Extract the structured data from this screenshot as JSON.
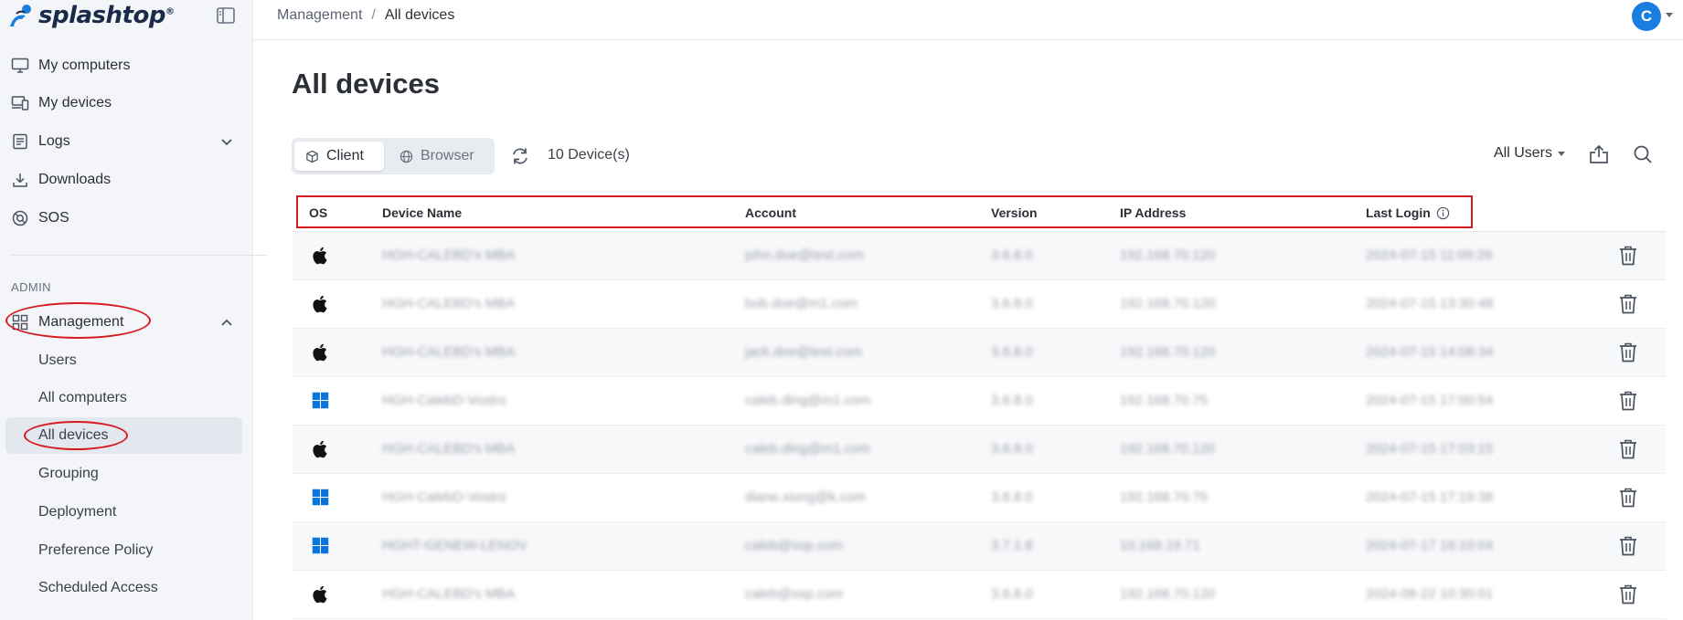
{
  "brand": {
    "name": "splashtop",
    "reg": "®"
  },
  "breadcrumb": {
    "parent": "Management",
    "separator": "/",
    "current": "All devices"
  },
  "user": {
    "initial": "C"
  },
  "sidebar": {
    "items": [
      {
        "label": "My computers",
        "icon": "monitor-icon"
      },
      {
        "label": "My devices",
        "icon": "devices-icon"
      },
      {
        "label": "Logs",
        "icon": "logs-icon"
      },
      {
        "label": "Downloads",
        "icon": "download-icon"
      },
      {
        "label": "SOS",
        "icon": "sos-icon"
      }
    ],
    "admin_label": "ADMIN",
    "management_label": "Management",
    "management_items": [
      "Users",
      "All computers",
      "All devices",
      "Grouping",
      "Deployment",
      "Preference Policy",
      "Scheduled Access"
    ]
  },
  "page": {
    "title": "All devices",
    "tabs": {
      "client": "Client",
      "browser": "Browser"
    },
    "device_count": "10 Device(s)",
    "user_filter": "All Users"
  },
  "table": {
    "headers": {
      "os": "OS",
      "device_name": "Device Name",
      "account": "Account",
      "version": "Version",
      "ip": "IP Address",
      "last_login": "Last Login"
    },
    "rows": [
      {
        "os": "apple",
        "device": "HGH-CALEBD's MBA",
        "account": "john.doe@test.com",
        "version": "3.6.8.0",
        "ip": "192.168.70.120",
        "last_login": "2024-07-15 11:09:29"
      },
      {
        "os": "apple",
        "device": "HGH-CALEBD's MBA",
        "account": "bob.doe@m1.com",
        "version": "3.6.8.0",
        "ip": "192.168.70.120",
        "last_login": "2024-07-15 13:30:48"
      },
      {
        "os": "apple",
        "device": "HGH-CALEBD's MBA",
        "account": "jack.doe@test.com",
        "version": "3.6.8.0",
        "ip": "192.168.70.120",
        "last_login": "2024-07-15 14:08:34"
      },
      {
        "os": "windows",
        "device": "HGH-CalebD-Vostro",
        "account": "caleb.ding@m1.com",
        "version": "3.6.8.0",
        "ip": "192.168.70.75",
        "last_login": "2024-07-15 17:00:54"
      },
      {
        "os": "apple",
        "device": "HGH-CALEBD's MBA",
        "account": "caleb.ding@m1.com",
        "version": "3.6.8.0",
        "ip": "192.168.70.120",
        "last_login": "2024-07-15 17:03:15"
      },
      {
        "os": "windows",
        "device": "HGH-CalebD-Vostro",
        "account": "diane.xiong@k.com",
        "version": "3.6.8.0",
        "ip": "192.168.70.75",
        "last_login": "2024-07-15 17:19:38"
      },
      {
        "os": "windows",
        "device": "HGHT-GENEW-LENOV",
        "account": "caleb@ssp.com",
        "version": "3.7.1.8",
        "ip": "10.168.19.71",
        "last_login": "2024-07-17 16:10:04"
      },
      {
        "os": "apple",
        "device": "HGH-CALEBD's MBA",
        "account": "caleb@ssp.com",
        "version": "3.6.8.0",
        "ip": "192.168.70.120",
        "last_login": "2024-08-22 10:30:01"
      }
    ]
  },
  "colors": {
    "accent": "#1a7de0",
    "annotation": "#d71920",
    "windows": "#0a74da"
  }
}
